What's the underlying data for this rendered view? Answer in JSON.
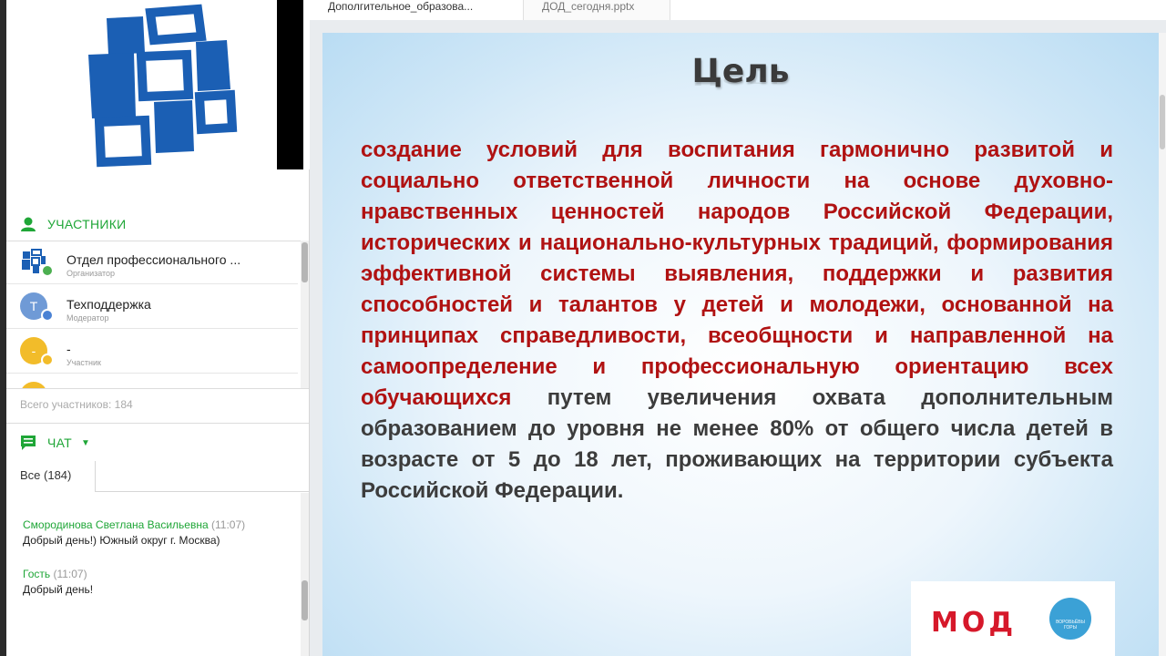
{
  "tabs": [
    {
      "label": "Дополгительное_образова..."
    },
    {
      "label": "ДОД_сегодня.pptx"
    }
  ],
  "participants": {
    "header": "УЧАСТНИКИ",
    "items": [
      {
        "name": "Отдел профессионального ...",
        "role": "Организатор",
        "avatar_color": "#1b5fb4",
        "badge_color": "#4caf50"
      },
      {
        "name": "Техподдержка",
        "role": "Модератор",
        "avatar_letter": "Т",
        "avatar_color": "#6f9ad6",
        "badge_color": "#4a82d4"
      },
      {
        "name": "-",
        "role": "Участник",
        "avatar_letter": "-",
        "avatar_color": "#f2bc2a",
        "badge_color": "#f2bc2a"
      }
    ],
    "total": "Всего участников: 184"
  },
  "chat": {
    "header": "ЧАТ",
    "tab_label": "Все (184)",
    "messages": [
      {
        "author": "Смородинова Светлана Васильевна",
        "time": "(11:07)",
        "text": "Добрый день!) Южный округ  г. Москва)"
      },
      {
        "author": "Гость",
        "time": "(11:07)",
        "text": "Добрый день!"
      }
    ]
  },
  "slide": {
    "title": "Цель",
    "body_red": "создание условий для воспитания гармонично развитой и социально ответственной личности на основе духовно-нравственных ценностей народов Российской Федерации, исторических и национально-культурных традиций, формирования эффективной системы выявления, поддержки и развития способностей и талантов у детей и молодежи, основанной на принципах справедливости, всеобщности и направленной на самоопределение и профессиональную ориентацию всех обучающихся",
    "body_gray": " путем увеличения охвата дополнительным образованием до уровня не менее 80% от общего числа детей в возрасте от 5 до 18 лет, проживающих на территории субъекта Российской Федерации.",
    "logo_text": "МОД",
    "logo_circle_text": "ВОРОБЬЁВЫ ГОРЫ"
  },
  "colors": {
    "accent_green": "#1fa637",
    "slide_red": "#b01212",
    "logo_blue": "#1b5fb4"
  }
}
